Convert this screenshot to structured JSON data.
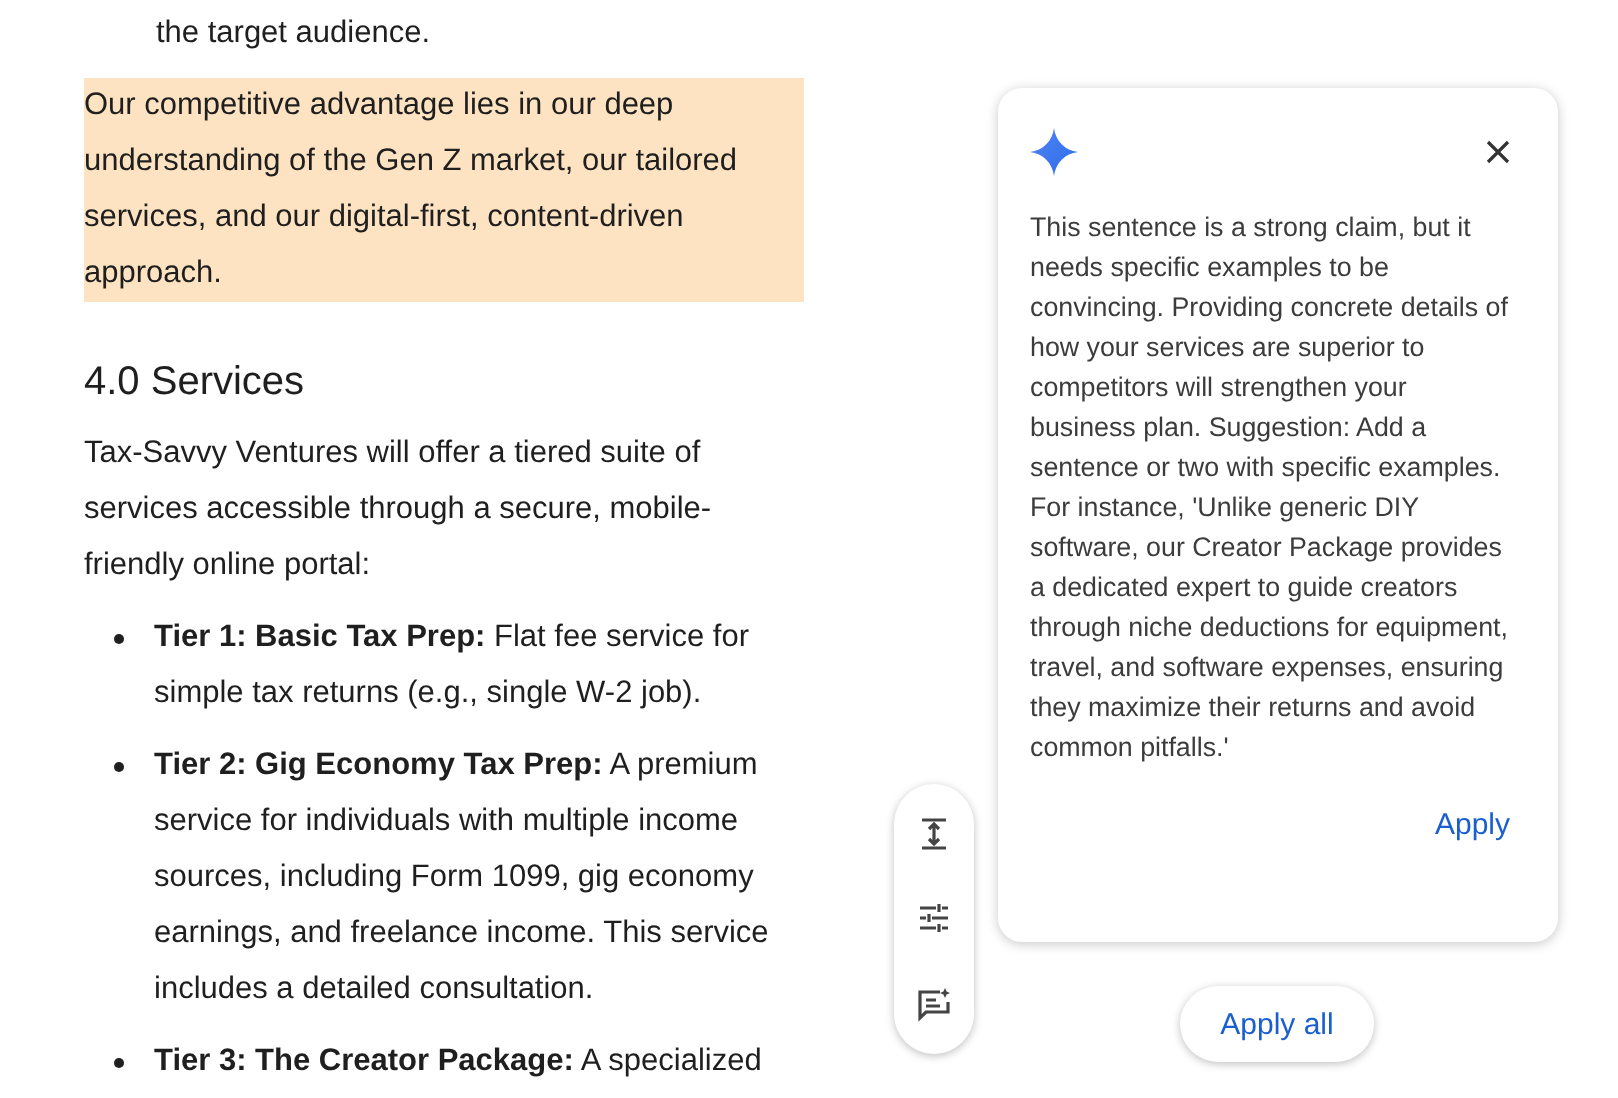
{
  "document": {
    "continued_text": "the target audience.",
    "highlighted_paragraph": "Our competitive advantage lies in our deep understanding of the Gen Z market, our tailored services, and our digital-first, content-driven approach.",
    "heading": "4.0 Services",
    "paragraph": "Tax-Savvy Ventures will offer a tiered suite of services accessible through a secure, mobile-friendly online portal:",
    "list": [
      {
        "text": "**Tier 1: Basic Tax Prep:** Flat fee service for simple tax returns (e.g., single W-2 job)."
      },
      {
        "text": "**Tier 2: Gig Economy Tax Prep:** A premium service for individuals with multiple income sources, including Form 1099, gig economy earnings, and freelance income. This service includes a detailed consultation."
      },
      {
        "text": "**Tier 3: The Creator Package:** A specialized"
      }
    ]
  },
  "toolbar": [
    {
      "kind": "expand"
    },
    {
      "kind": "adjust"
    },
    {
      "kind": "note"
    }
  ],
  "suggestion_card": {
    "text": "This sentence is a strong claim, but it needs specific examples to be convincing. Providing concrete details of how your services are superior to competitors will strengthen your business plan. Suggestion: Add a sentence or two with specific examples. For instance, 'Unlike generic DIY software, our Creator Package provides a dedicated expert to guide creators through niche deductions for equipment, travel, and software expenses, ensuring they maximize their returns and avoid common pitfalls.'",
    "apply_label": "Apply"
  },
  "apply_all_label": "Apply all"
}
